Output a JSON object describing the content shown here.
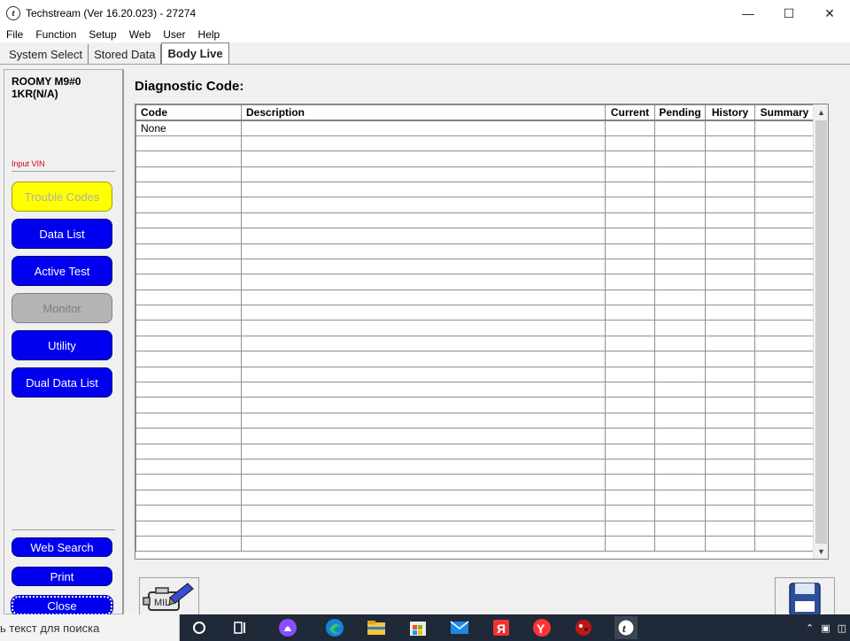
{
  "window": {
    "title": "Techstream (Ver 16.20.023) - 27274",
    "controls": {
      "minimize": "—",
      "maximize": "☐",
      "close": "✕"
    }
  },
  "menu": [
    "File",
    "Function",
    "Setup",
    "Web",
    "User",
    "Help"
  ],
  "tabs": [
    {
      "label": "System Select",
      "active": false
    },
    {
      "label": "Stored Data",
      "active": false
    },
    {
      "label": "Body Live",
      "active": true
    }
  ],
  "sidebar": {
    "vehicle_line1": "ROOMY M9#0",
    "vehicle_line2": "1KR(N/A)",
    "input_vin": "Input VIN",
    "buttons": [
      {
        "label": "Trouble Codes",
        "state": "active"
      },
      {
        "label": "Data List",
        "state": "normal"
      },
      {
        "label": "Active Test",
        "state": "normal"
      },
      {
        "label": "Monitor",
        "state": "disabled"
      },
      {
        "label": "Utility",
        "state": "normal"
      },
      {
        "label": "Dual Data List",
        "state": "normal"
      }
    ],
    "bottom_buttons": [
      "Web Search",
      "Print",
      "Close"
    ]
  },
  "main": {
    "title": "Diagnostic Code:",
    "columns": [
      "Code",
      "Description",
      "Current",
      "Pending",
      "History",
      "Summary"
    ],
    "rows": [
      [
        "None",
        "",
        "",
        "",
        "",
        ""
      ]
    ]
  },
  "taskbar": {
    "search_placeholder": "ь текст для поиска",
    "icons": [
      "search-circle-icon",
      "task-view-icon",
      "alice-icon",
      "edge-icon",
      "file-explorer-icon",
      "store-icon",
      "mail-icon",
      "yandex-icon",
      "yandex-browser-icon",
      "game-icon",
      "techstream-icon"
    ]
  },
  "colors": {
    "button_blue": "#0000ee",
    "button_yellow": "#ffff00",
    "button_gray": "#b4b4b4",
    "input_vin_red": "#d00000",
    "taskbar": "#1f2937"
  }
}
